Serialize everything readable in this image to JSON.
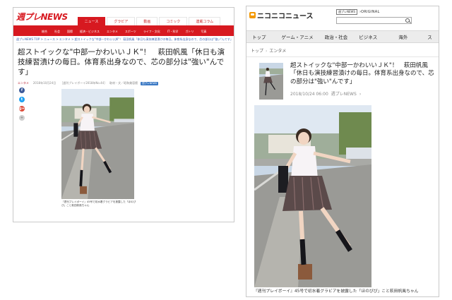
{
  "left": {
    "logo": "週プレNEWS",
    "tabs": [
      "ニュース",
      "グラビア",
      "動画",
      "コミック",
      "連載コラム"
    ],
    "subnav": [
      "総合",
      "社会",
      "国際",
      "経済・ビジネス",
      "エンタメ",
      "スポーツ",
      "ライフ・文化",
      "IT・科学",
      "ガトリ",
      "写真"
    ],
    "breadcrumb": "週プレNEWS TOP > ニュース > エンタメ > 超ストイックな\"中部一かわいいJK\"！ 萩田帆風「休日も演技練習漬けの毎日。体育系出身なので、芯の部分は\"強い\"んです」",
    "title": "超ストイックな\"中部一かわいいＪＫ\"！　萩田帆風「休日も演技練習漬けの毎日。体育系出身なので、芯の部分は\"強い\"んです」",
    "category": "エンタメ",
    "date": "2018年10月24日",
    "credit": "［週刊プレイボーイ2018年No.44］",
    "credit2": "取材・文／昭和美容館",
    "badge": "週プレNEWS",
    "share": {
      "fb": "f",
      "tw": "t",
      "gp": "g+",
      "more": "+"
    },
    "caption": "『週刊プレイボーイ』45号で初水着グラビアを披露した「ほのぴぴ」こと萩田帆風ちゃん"
  },
  "right": {
    "logo": "ニコニコニュース",
    "partner": "週プレNEWS",
    "original_label": "ORIGINAL",
    "nav": [
      "トップ",
      "ゲーム・アニメ",
      "政治・社会",
      "ビジネス",
      "海外",
      "ス"
    ],
    "breadcrumb": [
      "トップ",
      "エンタメ"
    ],
    "title": "超ストイックな\"中部一かわいいＪＫ\"！　萩田帆風「休日も演技練習漬けの毎日。体育系出身なので、芯の部分は\"強い\"んです」",
    "date": "2018/10/24 06:00",
    "source": "週プレNEWS",
    "caption": "『週刊プレイボーイ』45号で初水着グラビアを披露した「ほのぴぴ」こと萩田帆風ちゃん"
  },
  "colors": {
    "brand_red": "#d71920",
    "nico_orange": "#f39800",
    "link_blue": "#3a62b0"
  }
}
